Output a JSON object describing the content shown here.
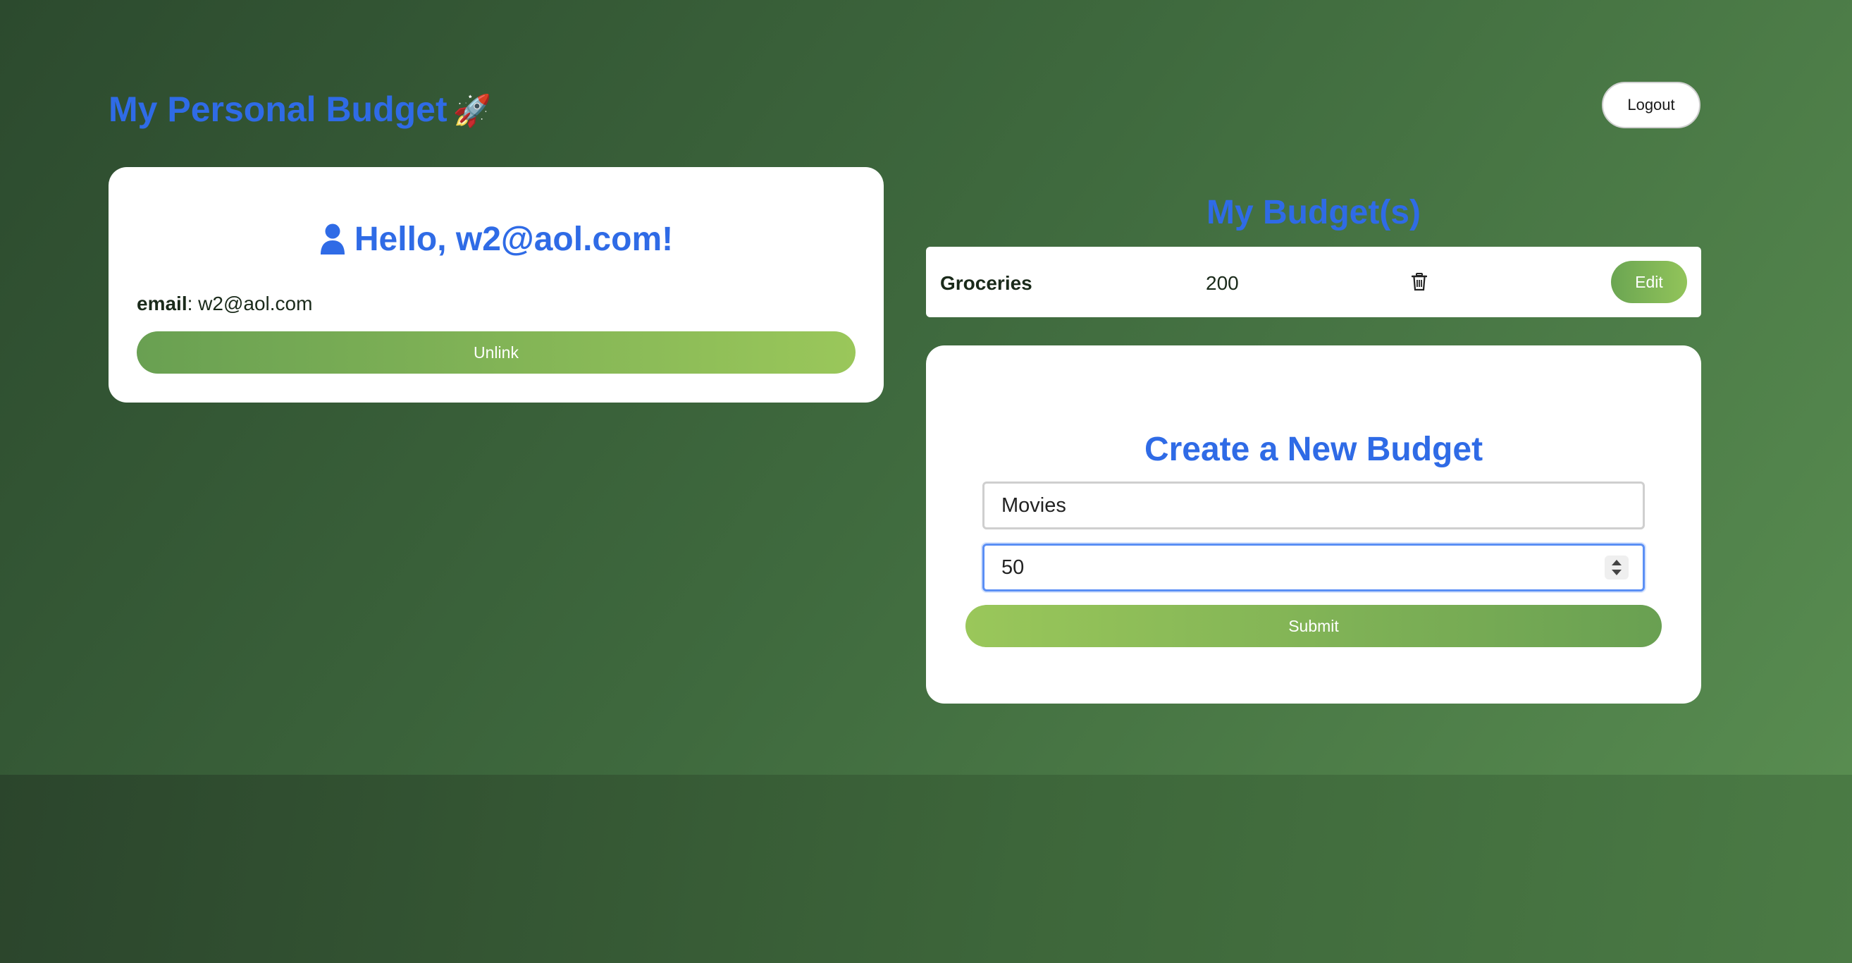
{
  "header": {
    "title": "My Personal Budget",
    "title_icon": "🚀",
    "logout_label": "Logout"
  },
  "profile": {
    "greeting": "Hello, w2@aol.com!",
    "email_label": "email",
    "email_value": "w2@aol.com",
    "unlink_label": "Unlink"
  },
  "budgets": {
    "heading": "My Budget(s)",
    "items": [
      {
        "name": "Groceries",
        "amount": "200",
        "edit_label": "Edit"
      }
    ]
  },
  "create_budget": {
    "heading": "Create a New Budget",
    "name_value": "Movies",
    "amount_value": "50",
    "submit_label": "Submit"
  },
  "colors": {
    "accent_blue": "#2f6be6",
    "button_green_start": "#69a052",
    "button_green_end": "#9ac75a"
  }
}
